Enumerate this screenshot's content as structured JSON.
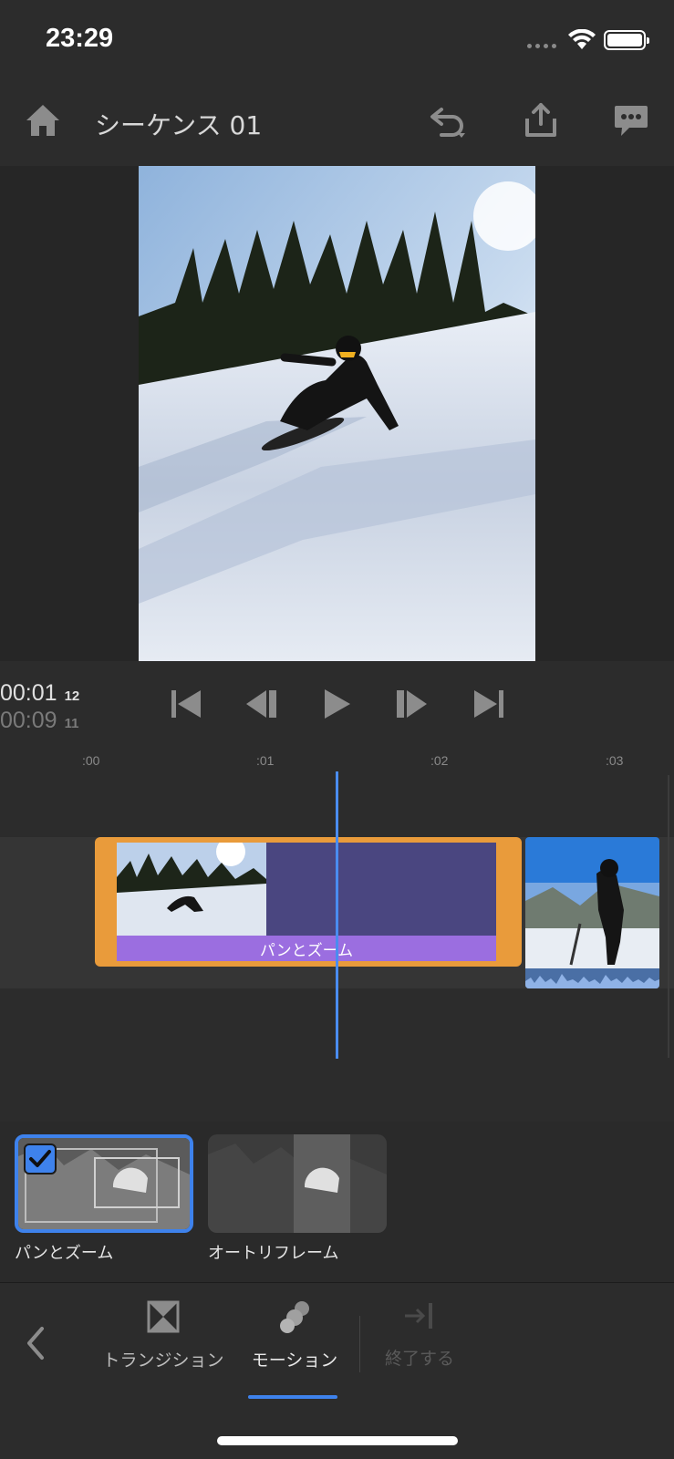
{
  "status_bar": {
    "time": "23:29"
  },
  "header": {
    "title": "シーケンス 01"
  },
  "playback": {
    "current_time": "00:01",
    "current_frames": "12",
    "duration": "00:09",
    "duration_frames": "11"
  },
  "timeline": {
    "ruler_marks": [
      ":00",
      ":01",
      ":02",
      ":03"
    ],
    "effect_label": "パンとズーム"
  },
  "effects": {
    "presets": [
      {
        "label": "パンとズーム",
        "selected": true
      },
      {
        "label": "オートリフレーム",
        "selected": false
      }
    ]
  },
  "toolbar": {
    "transition_label": "トランジション",
    "motion_label": "モーション",
    "finish_label": "終了する",
    "active_tool": "モーション"
  },
  "colors": {
    "accent_blue": "#3e82ec",
    "clip_orange": "#e99b3b",
    "effect_purple": "#9b6ee0",
    "playhead": "#4a8cf0"
  }
}
